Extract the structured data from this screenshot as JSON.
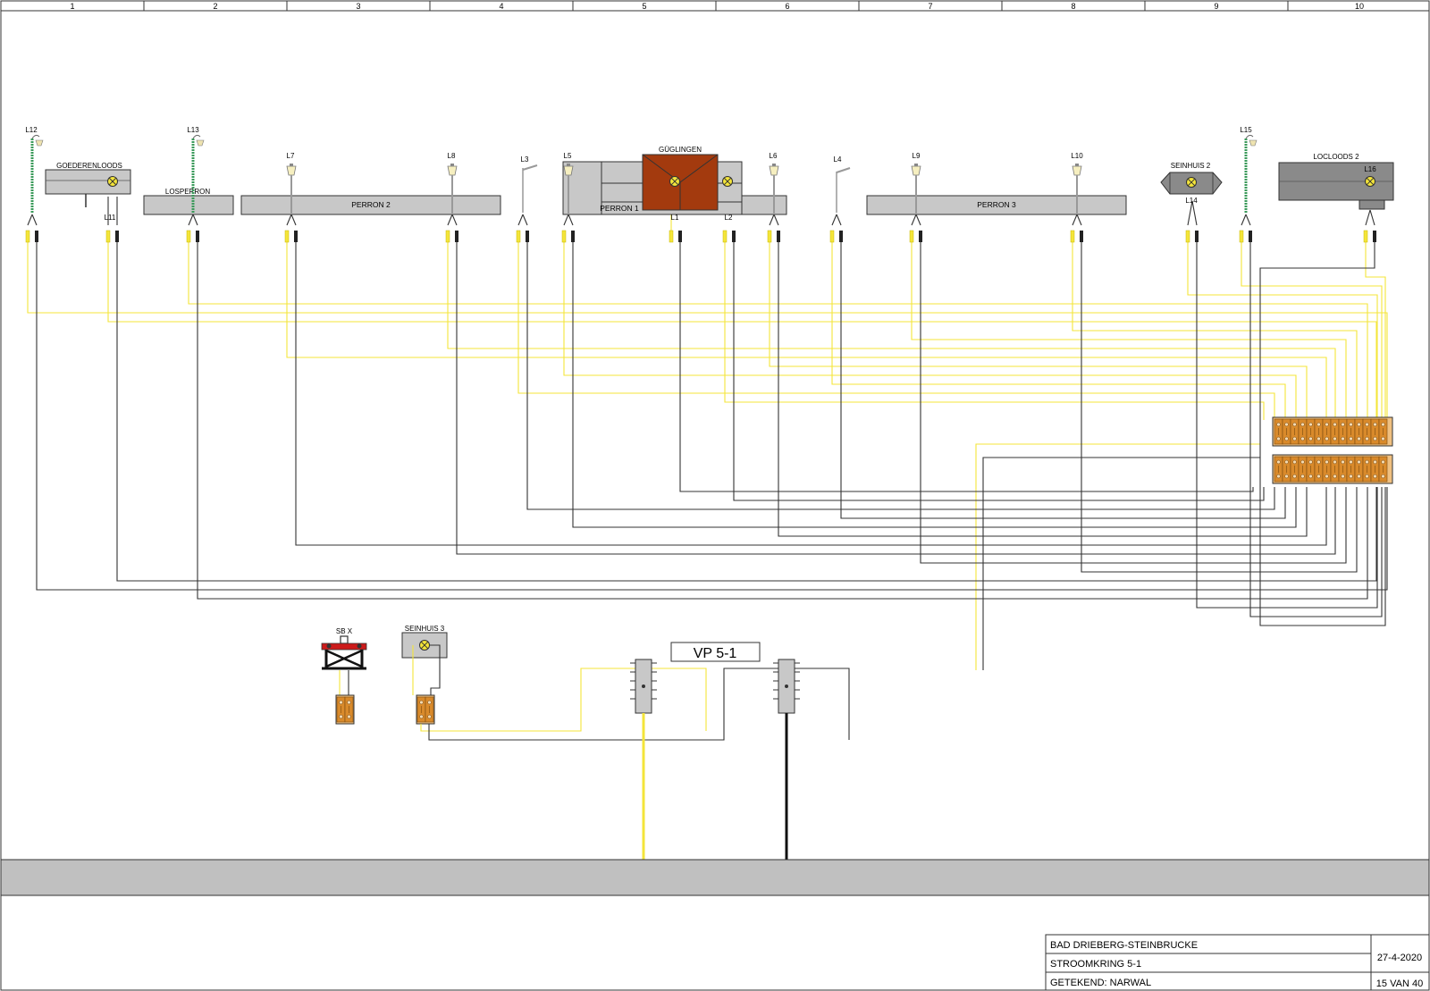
{
  "grid_columns": [
    "1",
    "2",
    "3",
    "4",
    "5",
    "6",
    "7",
    "8",
    "9",
    "10"
  ],
  "buildings": {
    "goederenloods": "GOEDERENLOODS",
    "losperron": "LOSPERRON",
    "perron2": "PERRON 2",
    "perron1": "PERRON 1",
    "guglingen": "GÜGLINGEN",
    "perron3": "PERRON 3",
    "seinhuis2": "SEINHUIS 2",
    "locloods2": "LOCLOODS 2",
    "seinhuis3": "SEINHUIS 3",
    "sbx": "SB X"
  },
  "lamps": {
    "l1": "L1",
    "l2": "L2",
    "l3": "L3",
    "l4": "L4",
    "l5": "L5",
    "l6": "L6",
    "l7": "L7",
    "l8": "L8",
    "l9": "L9",
    "l10": "L10",
    "l11": "L11",
    "l12": "L12",
    "l13": "L13",
    "l14": "L14",
    "l15": "L15",
    "l16": "L16"
  },
  "vp_label": "VP 5-1",
  "title_block": {
    "layout": "BAD DRIEBERG-STEINBRUCKE",
    "circuit": "STROOMKRING 5-1",
    "drawn_by": "GETEKEND: NARWAL",
    "date": "27-4-2020",
    "sheet": "15 VAN 40"
  },
  "colors": {
    "positive_wire": "#f4e53a",
    "negative_wire": "#333333",
    "terminal_strip": "#d98a2b",
    "station_building": "#a33a0e",
    "bus_bar": "#c0c0c0",
    "signal_red": "#cc1a1a"
  }
}
